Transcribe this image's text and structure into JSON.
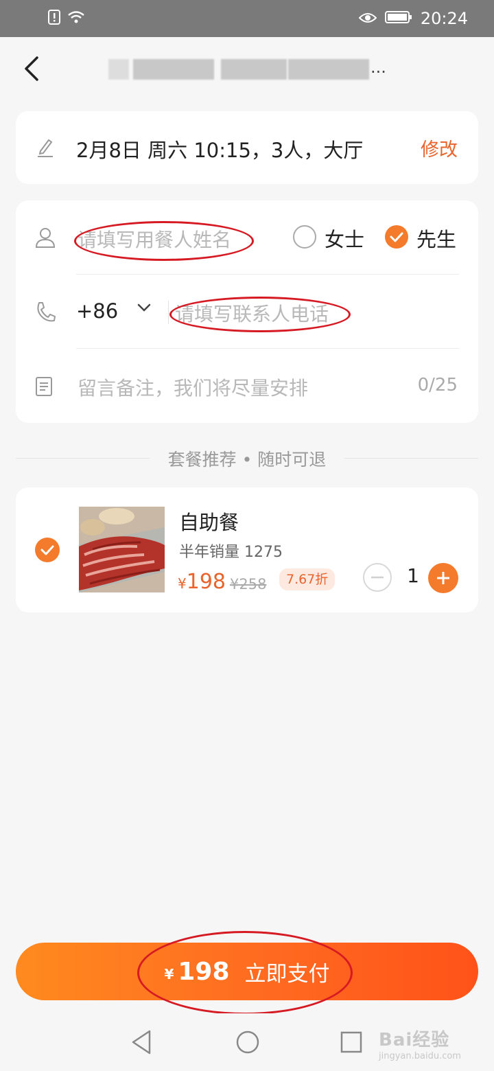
{
  "status_bar": {
    "time": "20:24",
    "icons": [
      "alert-icon",
      "wifi-icon",
      "eye-icon",
      "battery-icon"
    ]
  },
  "nav": {
    "title_suffix": "..."
  },
  "booking": {
    "summary": "2月8日 周六 10:15，3人，大厅",
    "modify_label": "修改"
  },
  "form": {
    "name_placeholder": "请填写用餐人姓名",
    "gender_options": [
      {
        "label": "女士",
        "checked": false
      },
      {
        "label": "先生",
        "checked": true
      }
    ],
    "country_code": "+86",
    "phone_placeholder": "请填写联系人电话",
    "note_placeholder": "留言备注，我们将尽量安排",
    "note_counter": "0/25"
  },
  "section": {
    "divider_label": "套餐推荐 • 随时可退"
  },
  "package": {
    "name": "自助餐",
    "sales": "半年销量 1275",
    "currency": "¥",
    "price": "198",
    "original_price": "¥258",
    "discount": "7.67折",
    "quantity": "1",
    "selected": true
  },
  "pay": {
    "currency": "¥",
    "amount": "198",
    "label": "立即支付"
  },
  "watermark": {
    "main": "Bai经验",
    "sub": "jingyan.baidu.com"
  },
  "colors": {
    "accent": "#f47a2c",
    "annotation_red": "#d61a23",
    "status_bar": "#7a7a7a"
  }
}
